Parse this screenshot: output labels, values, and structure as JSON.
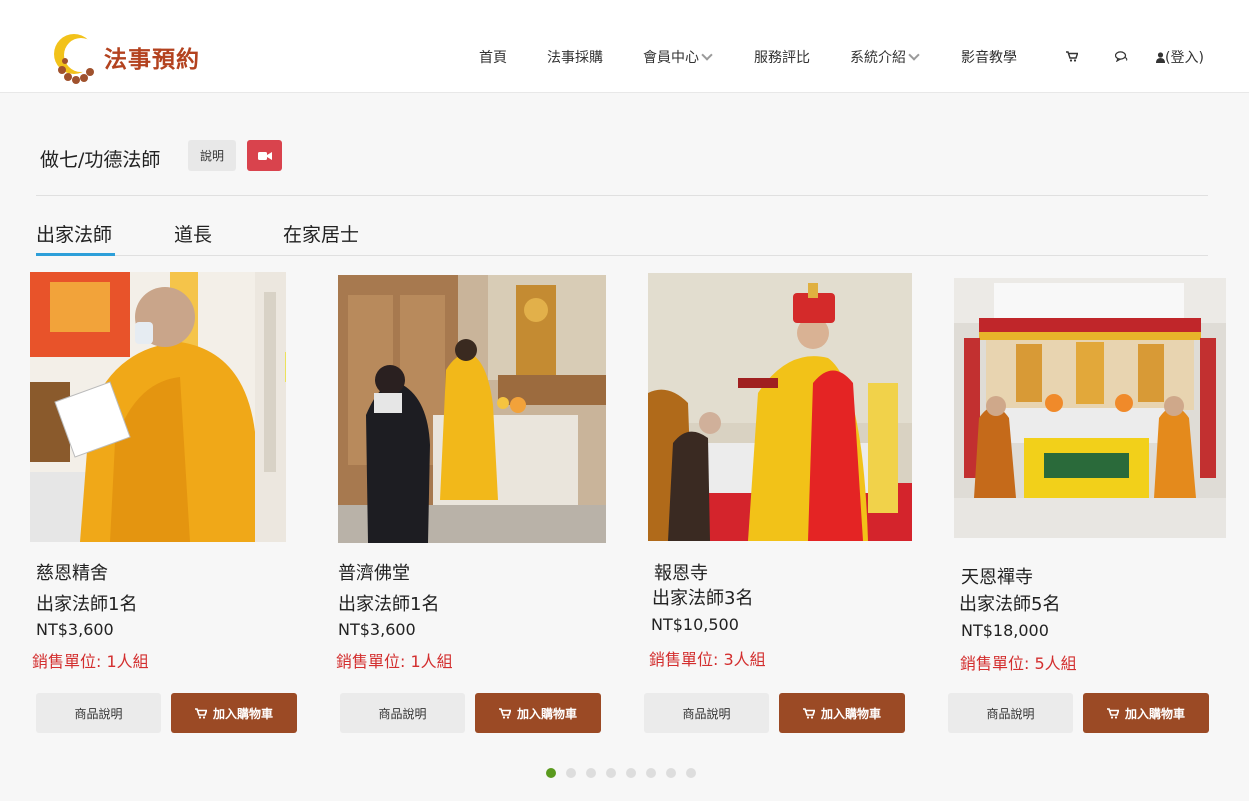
{
  "brand": {
    "name": "法事預約"
  },
  "nav": {
    "home": "首頁",
    "purchase": "法事採購",
    "member": "會員中心",
    "review": "服務評比",
    "system": "系統介紹",
    "video": "影音教學",
    "cart_icon": "cart-icon",
    "chat_icon": "chat-icon",
    "login": "(登入)"
  },
  "section": {
    "title": "做七/功德法師",
    "desc_button": "說明",
    "video_icon": "video-camera-icon",
    "video_color": "#d9434d"
  },
  "tabs": [
    {
      "label": "出家法師",
      "active": true
    },
    {
      "label": "道長",
      "active": false
    },
    {
      "label": "在家居士",
      "active": false
    }
  ],
  "products": [
    {
      "temple": "慈恩精舍",
      "title": "出家法師1名",
      "price": "NT$3,600",
      "unit": "銷售單位: 1人組",
      "info_button": "商品說明",
      "cart_button": "加入購物車"
    },
    {
      "temple": "普濟佛堂",
      "title": "出家法師1名",
      "price": "NT$3,600",
      "unit": "銷售單位: 1人組",
      "info_button": "商品說明",
      "cart_button": "加入購物車"
    },
    {
      "temple": "報恩寺",
      "title": "出家法師3名",
      "price": "NT$10,500",
      "unit": "銷售單位:  3人組",
      "info_button": "商品說明",
      "cart_button": "加入購物車"
    },
    {
      "temple": "天恩禪寺",
      "title": "出家法師5名",
      "price": "NT$18,000",
      "unit": "銷售單位:  5人組",
      "info_button": "商品說明",
      "cart_button": "加入購物車"
    }
  ],
  "carousel": {
    "pages": 8,
    "active_index": 0,
    "active_color": "#5a9a1e"
  },
  "colors": {
    "accent": "#9b4a25",
    "tab_underline": "#2d9fd9",
    "unit_text": "#d32f2f",
    "brand": "#b3421f"
  }
}
